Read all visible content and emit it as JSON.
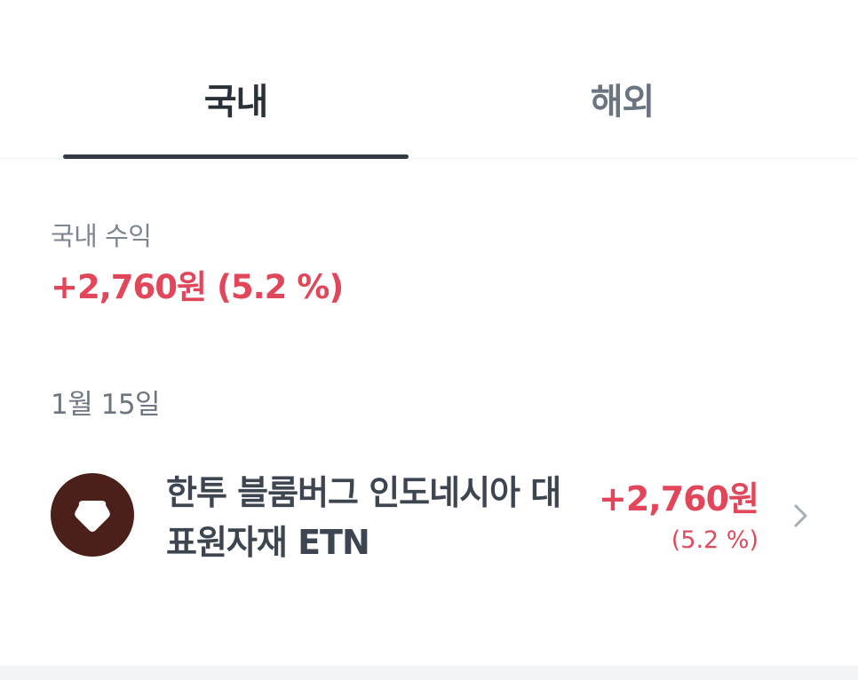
{
  "tabs": {
    "domestic": "국내",
    "overseas": "해외",
    "selected": "국내"
  },
  "summary": {
    "label": "국내 수익",
    "value": "+2,760원 (5.2 %)"
  },
  "date": "1월 15일",
  "items": [
    {
      "name": "한투 블룸버그 인도네시아 대표원자재 ETN",
      "amount": "+2,760원",
      "rate": "(5.2 %)",
      "logo_icon": "gem-logo-icon",
      "logo_color": "#4b1f1a"
    }
  ],
  "colors": {
    "profit": "#e2465a",
    "tab_active": "#2a3038",
    "tab_inactive": "#6b7480"
  }
}
